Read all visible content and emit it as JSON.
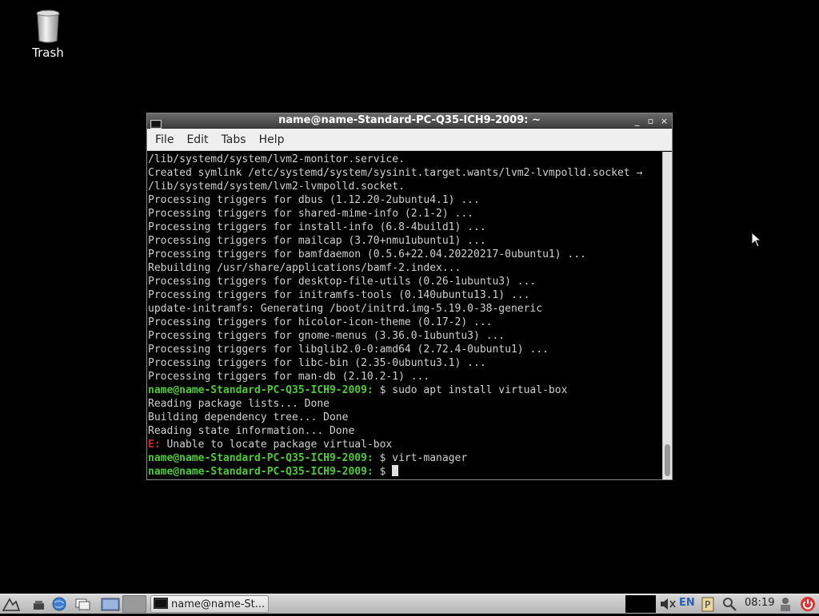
{
  "desktop": {
    "trash_label": "Trash"
  },
  "window": {
    "title": "name@name-Standard-PC-Q35-ICH9-2009: ~",
    "buttons": {
      "minimize": "_",
      "maximize": "▫",
      "close": "×"
    },
    "menu": [
      "File",
      "Edit",
      "Tabs",
      "Help"
    ]
  },
  "terminal": {
    "lines": [
      {
        "text": "/lib/systemd/system/lvm2-monitor.service."
      },
      {
        "text": "Created symlink /etc/systemd/system/sysinit.target.wants/lvm2-lvmpolld.socket →"
      },
      {
        "text": "/lib/systemd/system/lvm2-lvmpolld.socket."
      },
      {
        "text": "Processing triggers for dbus (1.12.20-2ubuntu4.1) ..."
      },
      {
        "text": "Processing triggers for shared-mime-info (2.1-2) ..."
      },
      {
        "text": "Processing triggers for install-info (6.8-4build1) ..."
      },
      {
        "text": "Processing triggers for mailcap (3.70+nmu1ubuntu1) ..."
      },
      {
        "text": "Processing triggers for bamfdaemon (0.5.6+22.04.20220217-0ubuntu1) ..."
      },
      {
        "text": "Rebuilding /usr/share/applications/bamf-2.index..."
      },
      {
        "text": "Processing triggers for desktop-file-utils (0.26-1ubuntu3) ..."
      },
      {
        "text": "Processing triggers for initramfs-tools (0.140ubuntu13.1) ..."
      },
      {
        "text": "update-initramfs: Generating /boot/initrd.img-5.19.0-38-generic"
      },
      {
        "text": "Processing triggers for hicolor-icon-theme (0.17-2) ..."
      },
      {
        "text": "Processing triggers for gnome-menus (3.36.0-1ubuntu3) ..."
      },
      {
        "text": "Processing triggers for libglib2.0-0:amd64 (2.72.4-0ubuntu1) ..."
      },
      {
        "text": "Processing triggers for libc-bin (2.35-0ubuntu3.1) ..."
      },
      {
        "text": "Processing triggers for man-db (2.10.2-1) ..."
      },
      {
        "prompt": "name@name-Standard-PC-Q35-ICH9-2009:",
        "text": " $ sudo apt install virtual-box"
      },
      {
        "text": "Reading package lists... Done"
      },
      {
        "text": "Building dependency tree... Done"
      },
      {
        "text": "Reading state information... Done"
      },
      {
        "error": "E:",
        "text": " Unable to locate package virtual-box"
      },
      {
        "prompt": "name@name-Standard-PC-Q35-ICH9-2009:",
        "text": " $ virt-manager"
      },
      {
        "prompt": "name@name-Standard-PC-Q35-ICH9-2009:",
        "text": " $ ",
        "cursor": true
      }
    ]
  },
  "taskbar": {
    "task_label": "name@name-St...",
    "lang": "EN",
    "clock": "08:19"
  },
  "colors": {
    "prompt": "#4fc93a",
    "error": "#d02a2a",
    "desktop": "#000000"
  }
}
